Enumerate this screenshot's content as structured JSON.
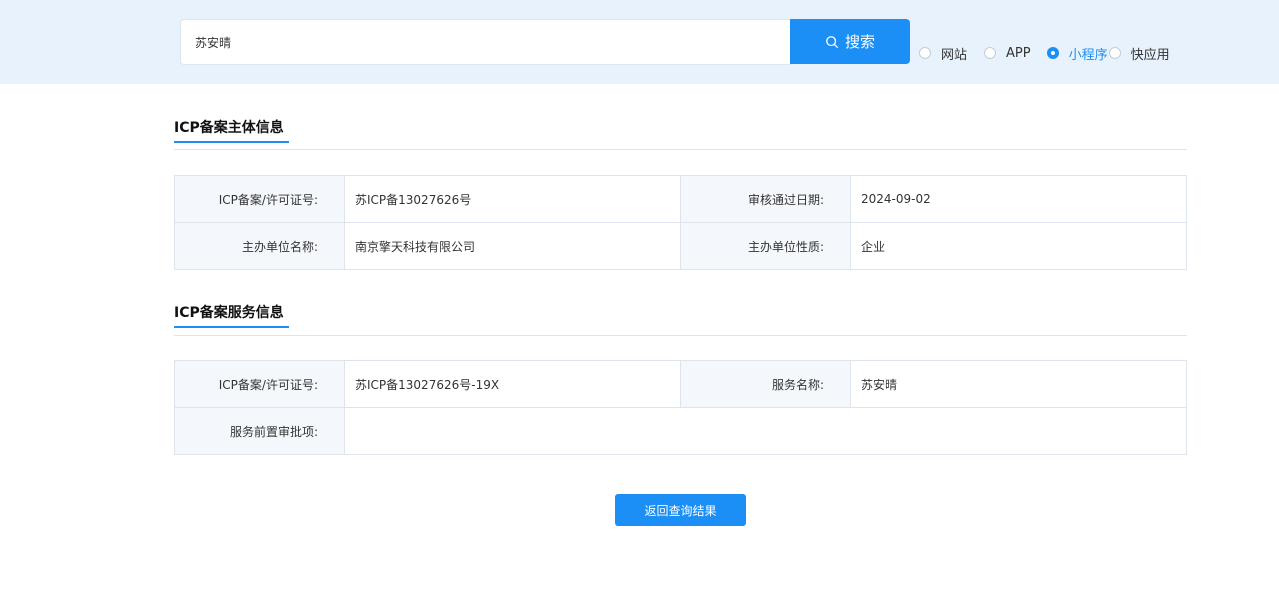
{
  "search": {
    "value": "苏安晴",
    "button_label": "搜索",
    "options": [
      {
        "label": "网站",
        "checked": false
      },
      {
        "label": "APP",
        "checked": false
      },
      {
        "label": "小程序",
        "checked": true
      },
      {
        "label": "快应用",
        "checked": false
      }
    ]
  },
  "subject_section": {
    "title": "ICP备案主体信息",
    "rows": [
      {
        "label1": "ICP备案/许可证号:",
        "value1": "苏ICP备13027626号",
        "label2": "审核通过日期:",
        "value2": "2024-09-02"
      },
      {
        "label1": "主办单位名称:",
        "value1": "南京擎天科技有限公司",
        "label2": "主办单位性质:",
        "value2": "企业"
      }
    ]
  },
  "service_section": {
    "title": "ICP备案服务信息",
    "row1": {
      "label1": "ICP备案/许可证号:",
      "value1": "苏ICP备13027626号-19X",
      "label2": "服务名称:",
      "value2": "苏安晴"
    },
    "row2": {
      "label": "服务前置审批项:",
      "value": ""
    }
  },
  "back_button": {
    "label": "返回查询结果"
  },
  "colors": {
    "accent": "#1b8ff5",
    "topbar": "#e7f2fd",
    "label_bg": "#f4f8fc"
  }
}
